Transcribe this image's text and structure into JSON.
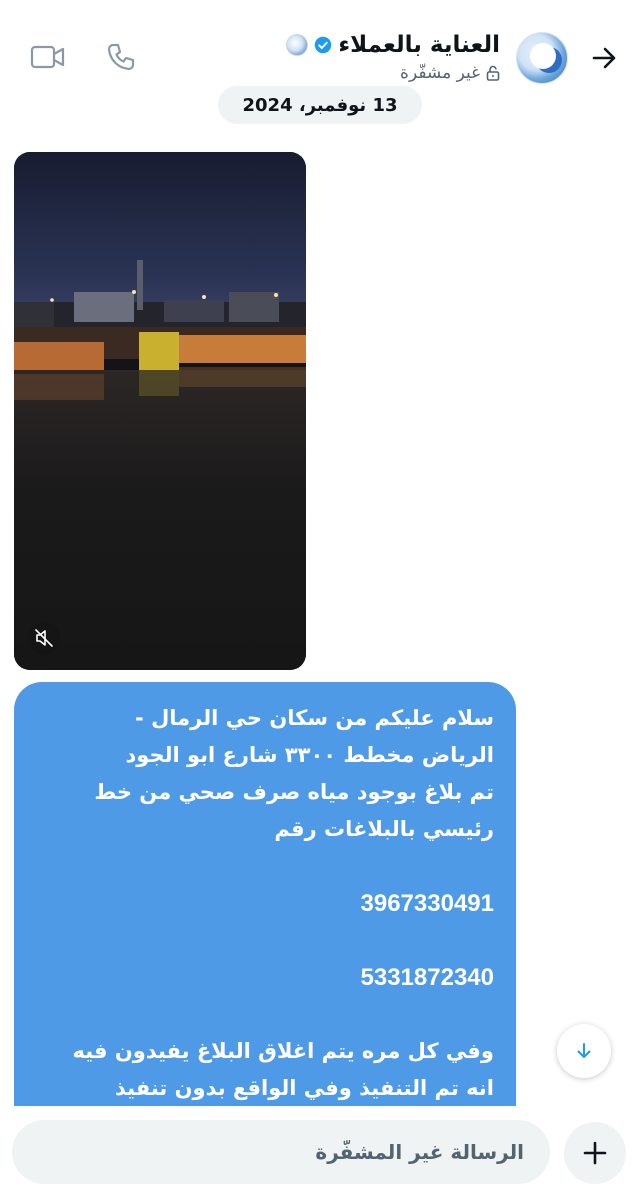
{
  "header": {
    "title": "العناية بالعملاء",
    "subtitle": "غير مشفّرة",
    "icons": {
      "back": "arrow-right-icon",
      "avatar": "brand-logo",
      "verified": "verified-badge-icon",
      "lock": "lock-icon",
      "phone": "phone-icon",
      "video": "video-camera-icon"
    }
  },
  "date_separator": "13 نوفمبر، 2024",
  "video_message": {
    "muted_icon": "speaker-muted-icon"
  },
  "message": {
    "lines": [
      "سلام عليكم من سكان حي الرمال -",
      "الرياض مخطط ٣٣٠٠  شارع ابو الجود",
      "تم بلاغ بوجود مياه صرف صحي من خط",
      "رئيسي  بالبلاغات رقم"
    ],
    "numbers": [
      "3967330491",
      "5331872340"
    ],
    "closing_lines": [
      "وفي كل مره يتم اغلاق البلاغ يفيدون فيه",
      "انه تم التنفيذ وفي الواقع بدون تنفيذ"
    ]
  },
  "scroll_down_icon": "arrow-down-icon",
  "composer": {
    "placeholder": "الرسالة غير المشفّرة",
    "add_icon": "plus-icon"
  },
  "colors": {
    "bubble": "#4f9ae6",
    "pill": "#eff3f4",
    "accent": "#1d9bf0",
    "muted_text": "#536471"
  }
}
